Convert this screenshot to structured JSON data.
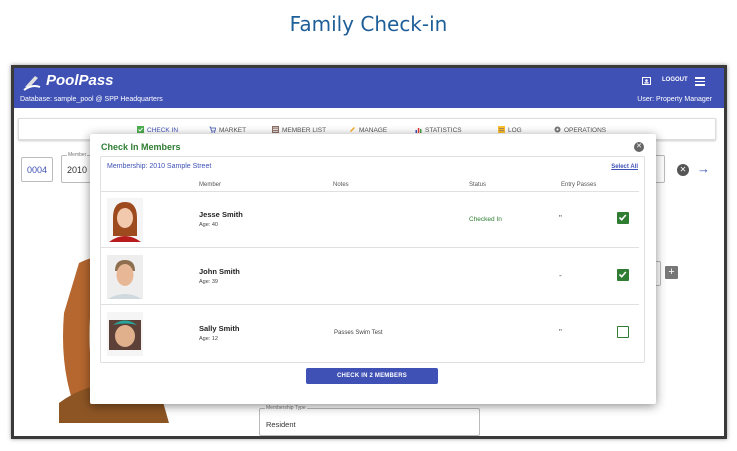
{
  "page_heading": "Family Check-in",
  "appbar": {
    "app_name": "PoolPass",
    "database": "Database: sample_pool @ SPP Headquarters",
    "logout_label": "LOGOUT",
    "user": "User: Property Manager",
    "color": "#3f51b5"
  },
  "nav": {
    "items": [
      {
        "label": "CHECK IN",
        "icon": "check-box-icon",
        "active": true
      },
      {
        "label": "MARKET",
        "icon": "cart-icon"
      },
      {
        "label": "MEMBER LIST",
        "icon": "list-icon"
      },
      {
        "label": "MANAGE",
        "icon": "pencil-icon"
      },
      {
        "label": "STATISTICS",
        "icon": "chart-icon"
      },
      {
        "label": "LOG",
        "icon": "log-icon"
      },
      {
        "label": "OPERATIONS",
        "icon": "gear-icon"
      }
    ]
  },
  "background": {
    "code": "0004",
    "membership_label": "Member",
    "membership_value": "2010",
    "membership_type_label": "Membership Type",
    "membership_type_value": "Resident"
  },
  "dialog": {
    "title": "Check In Members",
    "membership": "Membership: 2010 Sample Street",
    "select_all": "Select All",
    "columns": {
      "member": "Member",
      "notes": "Notes",
      "status": "Status",
      "entry_passes": "Entry Passes"
    },
    "members": [
      {
        "name": "Jesse Smith",
        "age": "Age: 40",
        "notes": "",
        "status": "Checked In",
        "passes": "\"",
        "checked": true
      },
      {
        "name": "John Smith",
        "age": "Age: 39",
        "notes": "",
        "status": "",
        "passes": "-",
        "checked": true
      },
      {
        "name": "Sally Smith",
        "age": "Age: 12",
        "notes": "Passes Swim Test",
        "status": "",
        "passes": "\"",
        "checked": false
      }
    ],
    "checkin_button": "CHECK IN 2 MEMBERS"
  },
  "colors": {
    "accent": "#3f51b5",
    "success": "#2e7d32"
  }
}
